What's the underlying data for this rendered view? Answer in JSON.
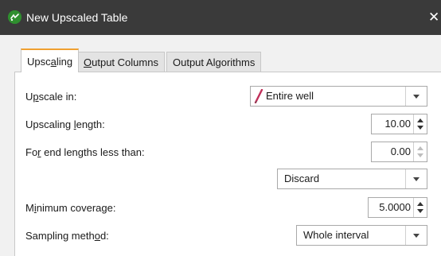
{
  "window": {
    "title": "New Upscaled Table",
    "close": "✕",
    "icon": "app-logo-icon"
  },
  "tabs": [
    {
      "pre": "Upsc",
      "u": "a",
      "post": "ling",
      "active": true
    },
    {
      "pre": "",
      "u": "O",
      "post": "utput Columns",
      "active": false
    },
    {
      "pre": "Output Algorithms",
      "u": "",
      "post": "",
      "active": false
    }
  ],
  "form": {
    "upscale_in": {
      "pre": "U",
      "u": "p",
      "post": "scale in:",
      "value": "Entire well",
      "icon": "pencil-curve-icon"
    },
    "upscaling_length": {
      "pre": "Upscaling ",
      "u": "l",
      "post": "ength:",
      "value": "10.00"
    },
    "end_lengths": {
      "pre": "Fo",
      "u": "r",
      "post": " end lengths less than:",
      "value": "0.00",
      "action": "Discard"
    },
    "minimum_coverage": {
      "pre": "M",
      "u": "i",
      "post": "nimum coverage:",
      "value": "5.0000"
    },
    "sampling_method": {
      "pre": "Sampling meth",
      "u": "o",
      "post": "d:",
      "value": "Whole interval"
    }
  },
  "colors": {
    "titlebar": "#3a3a3a",
    "active_tab_accent": "#f0a030",
    "icon_green": "#2f8f2f",
    "pencil": "#c0305a"
  }
}
